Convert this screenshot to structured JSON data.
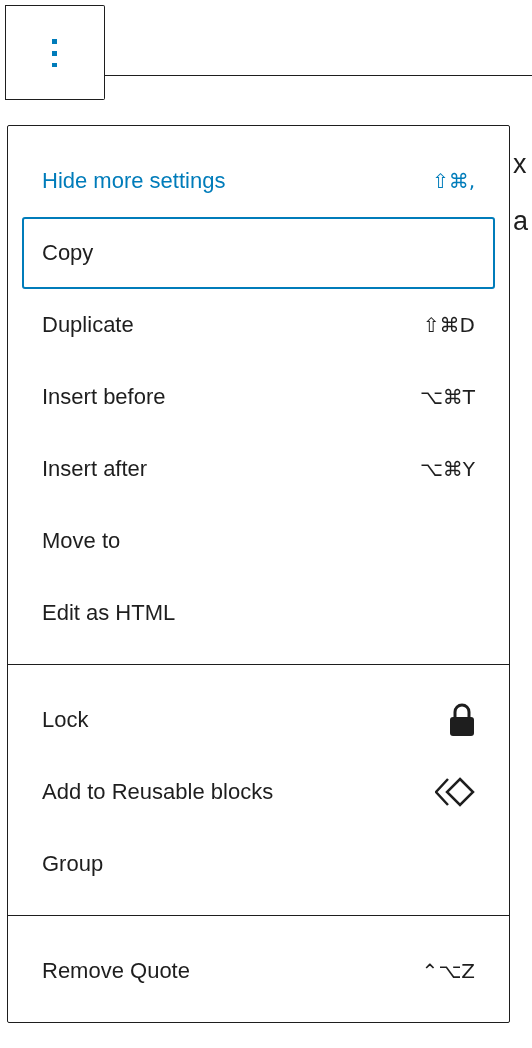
{
  "background_text": [
    {
      "right": "x"
    },
    {
      "right": "a"
    }
  ],
  "menu": {
    "sections": [
      {
        "items": [
          {
            "label": "Hide more settings",
            "shortcut": "⇧⌘,",
            "kind": "toggle",
            "focused": false
          },
          {
            "label": "Copy",
            "kind": "action",
            "focused": true
          },
          {
            "label": "Duplicate",
            "shortcut": "⇧⌘D",
            "kind": "action",
            "focused": false
          },
          {
            "label": "Insert before",
            "shortcut": "⌥⌘T",
            "kind": "action",
            "focused": false
          },
          {
            "label": "Insert after",
            "shortcut": "⌥⌘Y",
            "kind": "action",
            "focused": false
          },
          {
            "label": "Move to",
            "kind": "action",
            "focused": false
          },
          {
            "label": "Edit as HTML",
            "kind": "action",
            "focused": false
          }
        ]
      },
      {
        "items": [
          {
            "label": "Lock",
            "kind": "lock",
            "focused": false
          },
          {
            "label": "Add to Reusable blocks",
            "kind": "reusable",
            "focused": false
          },
          {
            "label": "Group",
            "kind": "action",
            "focused": false
          }
        ]
      },
      {
        "items": [
          {
            "label": "Remove Quote",
            "shortcut": "⌃⌥Z",
            "kind": "action",
            "focused": false
          }
        ]
      }
    ]
  }
}
